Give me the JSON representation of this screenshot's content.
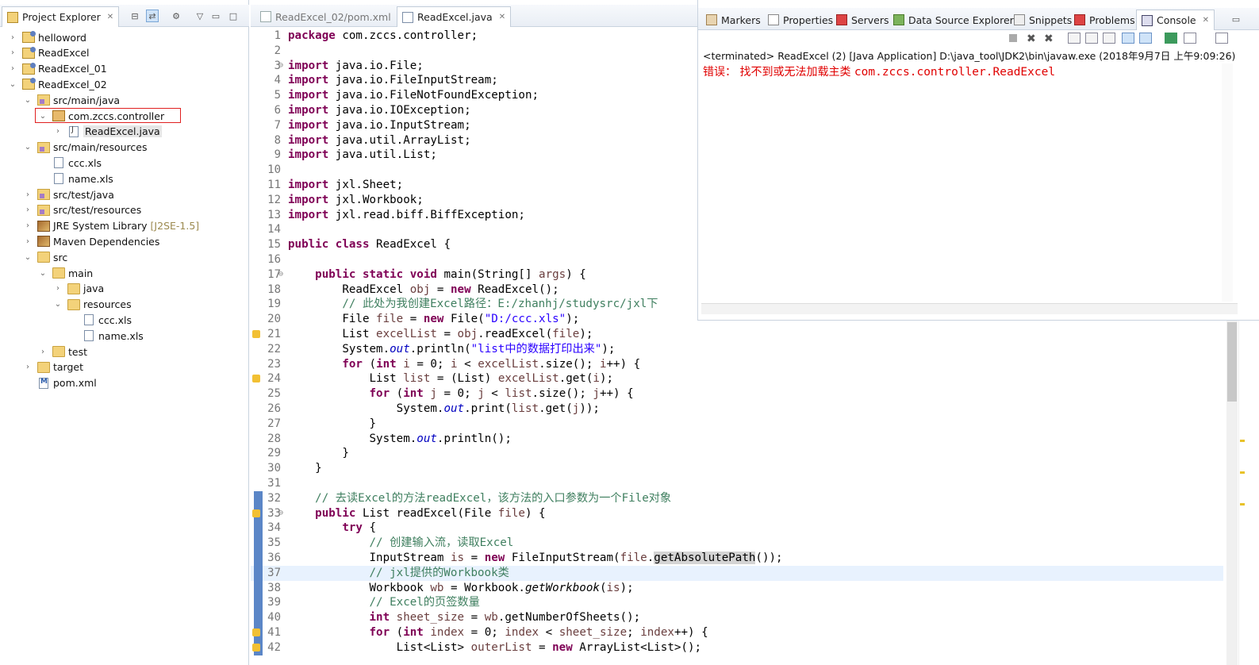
{
  "explorer": {
    "tab_label": "Project Explorer",
    "items": [
      {
        "label": "helloword",
        "depth": 0,
        "twisty": "›",
        "icon": "project-icon"
      },
      {
        "label": "ReadExcel",
        "depth": 0,
        "twisty": "›",
        "icon": "maven-project-icon"
      },
      {
        "label": "ReadExcel_01",
        "depth": 0,
        "twisty": "›",
        "icon": "project-icon"
      },
      {
        "label": "ReadExcel_02",
        "depth": 0,
        "twisty": "⌄",
        "icon": "maven-project-icon"
      },
      {
        "label": "src/main/java",
        "depth": 1,
        "twisty": "⌄",
        "icon": "source-folder-icon"
      },
      {
        "label": "com.zccs.controller",
        "depth": 2,
        "twisty": "⌄",
        "icon": "package-icon"
      },
      {
        "label": "ReadExcel.java",
        "depth": 3,
        "twisty": "›",
        "icon": "java-file-icon"
      },
      {
        "label": "src/main/resources",
        "depth": 1,
        "twisty": "⌄",
        "icon": "source-folder-icon"
      },
      {
        "label": "ccc.xls",
        "depth": 2,
        "twisty": "",
        "icon": "file-icon"
      },
      {
        "label": "name.xls",
        "depth": 2,
        "twisty": "",
        "icon": "file-icon"
      },
      {
        "label": "src/test/java",
        "depth": 1,
        "twisty": "›",
        "icon": "source-folder-icon"
      },
      {
        "label": "src/test/resources",
        "depth": 1,
        "twisty": "›",
        "icon": "source-folder-icon"
      },
      {
        "label": "JRE System Library",
        "depth": 1,
        "twisty": "›",
        "icon": "library-icon",
        "decor": "[J2SE-1.5]"
      },
      {
        "label": "Maven Dependencies",
        "depth": 1,
        "twisty": "›",
        "icon": "library-icon"
      },
      {
        "label": "src",
        "depth": 1,
        "twisty": "⌄",
        "icon": "folder-icon"
      },
      {
        "label": "main",
        "depth": 2,
        "twisty": "⌄",
        "icon": "folder-icon"
      },
      {
        "label": "java",
        "depth": 3,
        "twisty": "›",
        "icon": "folder-icon"
      },
      {
        "label": "resources",
        "depth": 3,
        "twisty": "⌄",
        "icon": "folder-icon"
      },
      {
        "label": "ccc.xls",
        "depth": 4,
        "twisty": "",
        "icon": "file-icon"
      },
      {
        "label": "name.xls",
        "depth": 4,
        "twisty": "",
        "icon": "file-icon"
      },
      {
        "label": "test",
        "depth": 2,
        "twisty": "›",
        "icon": "folder-icon"
      },
      {
        "label": "target",
        "depth": 1,
        "twisty": "›",
        "icon": "folder-icon"
      },
      {
        "label": "pom.xml",
        "depth": 1,
        "twisty": "",
        "icon": "xml-file-icon"
      }
    ]
  },
  "editor": {
    "tabs": [
      {
        "label": "ReadExcel_02/pom.xml",
        "active": false
      },
      {
        "label": "ReadExcel.java",
        "active": true
      }
    ]
  },
  "console": {
    "tabs": [
      "Markers",
      "Properties",
      "Servers",
      "Data Source Explorer",
      "Snippets",
      "Problems",
      "Console"
    ],
    "terminated": "<terminated> ReadExcel (2) [Java Application] D:\\java_tool\\JDK2\\bin\\javaw.exe (2018年9月7日 上午9:09:26)",
    "error_prefix": "错误：  找不到或无法加载主类 ",
    "error_class": "com.zccs.controller.ReadExcel"
  },
  "code_lines": [
    {
      "n": "1",
      "html": "<span class='kw'>package</span> com.zccs.controller;"
    },
    {
      "n": "2",
      "html": ""
    },
    {
      "n": "3",
      "fold": true,
      "html": "<span class='kw'>import</span> java.io.File;"
    },
    {
      "n": "4",
      "html": "<span class='kw'>import</span> java.io.FileInputStream;"
    },
    {
      "n": "5",
      "html": "<span class='kw'>import</span> java.io.FileNotFoundException;"
    },
    {
      "n": "6",
      "html": "<span class='kw'>import</span> java.io.IOException;"
    },
    {
      "n": "7",
      "html": "<span class='kw'>import</span> java.io.InputStream;"
    },
    {
      "n": "8",
      "html": "<span class='kw'>import</span> java.util.ArrayList;"
    },
    {
      "n": "9",
      "html": "<span class='kw'>import</span> java.util.List;"
    },
    {
      "n": "10",
      "html": ""
    },
    {
      "n": "11",
      "html": "<span class='kw'>import</span> jxl.Sheet;"
    },
    {
      "n": "12",
      "html": "<span class='kw'>import</span> jxl.Workbook;"
    },
    {
      "n": "13",
      "html": "<span class='kw'>import</span> jxl.read.biff.BiffException;"
    },
    {
      "n": "14",
      "html": ""
    },
    {
      "n": "15",
      "html": "<span class='kw'>public class</span> ReadExcel {"
    },
    {
      "n": "16",
      "html": ""
    },
    {
      "n": "17",
      "fold": true,
      "html": "    <span class='kw'>public static void</span> main(String[] <span class='var'>args</span>) {"
    },
    {
      "n": "18",
      "html": "        ReadExcel <span class='var'>obj</span> = <span class='kw'>new</span> ReadExcel();"
    },
    {
      "n": "19",
      "html": "        <span class='cm'>// 此处为我创建Excel路径：E:/zhanhj/studysrc/jxl下</span>"
    },
    {
      "n": "20",
      "html": "        File <span class='var'>file</span> = <span class='kw'>new</span> File(<span class='str'>\"D:/ccc.xls\"</span>);"
    },
    {
      "n": "21",
      "warn": true,
      "html": "        List <span class='var'>excelList</span> = <span class='var'>obj</span>.readExcel(<span class='var'>file</span>);"
    },
    {
      "n": "22",
      "html": "        System.<span class='fld'>out</span>.println(<span class='str'>\"list中的数据打印出来\"</span>);"
    },
    {
      "n": "23",
      "html": "        <span class='kw'>for</span> (<span class='kw'>int</span> <span class='var'>i</span> = 0; <span class='var'>i</span> &lt; <span class='var'>excelList</span>.size(); <span class='var'>i</span>++) {"
    },
    {
      "n": "24",
      "warn": true,
      "html": "            List <span class='var'>list</span> = (List) <span class='var'>excelList</span>.get(<span class='var'>i</span>);"
    },
    {
      "n": "25",
      "html": "            <span class='kw'>for</span> (<span class='kw'>int</span> <span class='var'>j</span> = 0; <span class='var'>j</span> &lt; <span class='var'>list</span>.size(); <span class='var'>j</span>++) {"
    },
    {
      "n": "26",
      "html": "                System.<span class='fld'>out</span>.print(<span class='var'>list</span>.get(<span class='var'>j</span>));"
    },
    {
      "n": "27",
      "html": "            }"
    },
    {
      "n": "28",
      "html": "            System.<span class='fld'>out</span>.println();"
    },
    {
      "n": "29",
      "html": "        }"
    },
    {
      "n": "30",
      "html": "    }"
    },
    {
      "n": "31",
      "html": ""
    },
    {
      "n": "32",
      "bar": true,
      "html": "    <span class='cm'>// 去读Excel的方法readExcel，该方法的入口参数为一个File对象</span>"
    },
    {
      "n": "33",
      "bar": true,
      "fold": true,
      "warn": true,
      "html": "    <span class='kw'>public</span> List readExcel(File <span class='var'>file</span>) {"
    },
    {
      "n": "34",
      "bar": true,
      "html": "        <span class='kw'>try</span> {"
    },
    {
      "n": "35",
      "bar": true,
      "html": "            <span class='cm'>// 创建输入流，读取Excel</span>"
    },
    {
      "n": "36",
      "bar": true,
      "html": "            InputStream <span class='var'>is</span> = <span class='kw'>new</span> FileInputStream(<span class='var'>file</span>.<span class='hilite'>getAbsolutePath</span>());"
    },
    {
      "n": "37",
      "bar": true,
      "hl": true,
      "html": "            <span class='cm'>// jxl提供的Workbook类</span>"
    },
    {
      "n": "38",
      "bar": true,
      "html": "            Workbook <span class='var'>wb</span> = Workbook.<span class='it'>getWorkbook</span>(<span class='var'>is</span>);"
    },
    {
      "n": "39",
      "bar": true,
      "html": "            <span class='cm'>// Excel的页签数量</span>"
    },
    {
      "n": "40",
      "bar": true,
      "html": "            <span class='kw'>int</span> <span class='var'>sheet_size</span> = <span class='var'>wb</span>.getNumberOfSheets();"
    },
    {
      "n": "41",
      "bar": true,
      "warn": true,
      "html": "            <span class='kw'>for</span> (<span class='kw'>int</span> <span class='var'>index</span> = 0; <span class='var'>index</span> &lt; <span class='var'>sheet_size</span>; <span class='var'>index</span>++) {"
    },
    {
      "n": "42",
      "bar": true,
      "warn": true,
      "html": "                List&lt;List&gt; <span class='var'>outerList</span> = <span class='kw'>new</span> ArrayList&lt;List&gt;();"
    }
  ]
}
